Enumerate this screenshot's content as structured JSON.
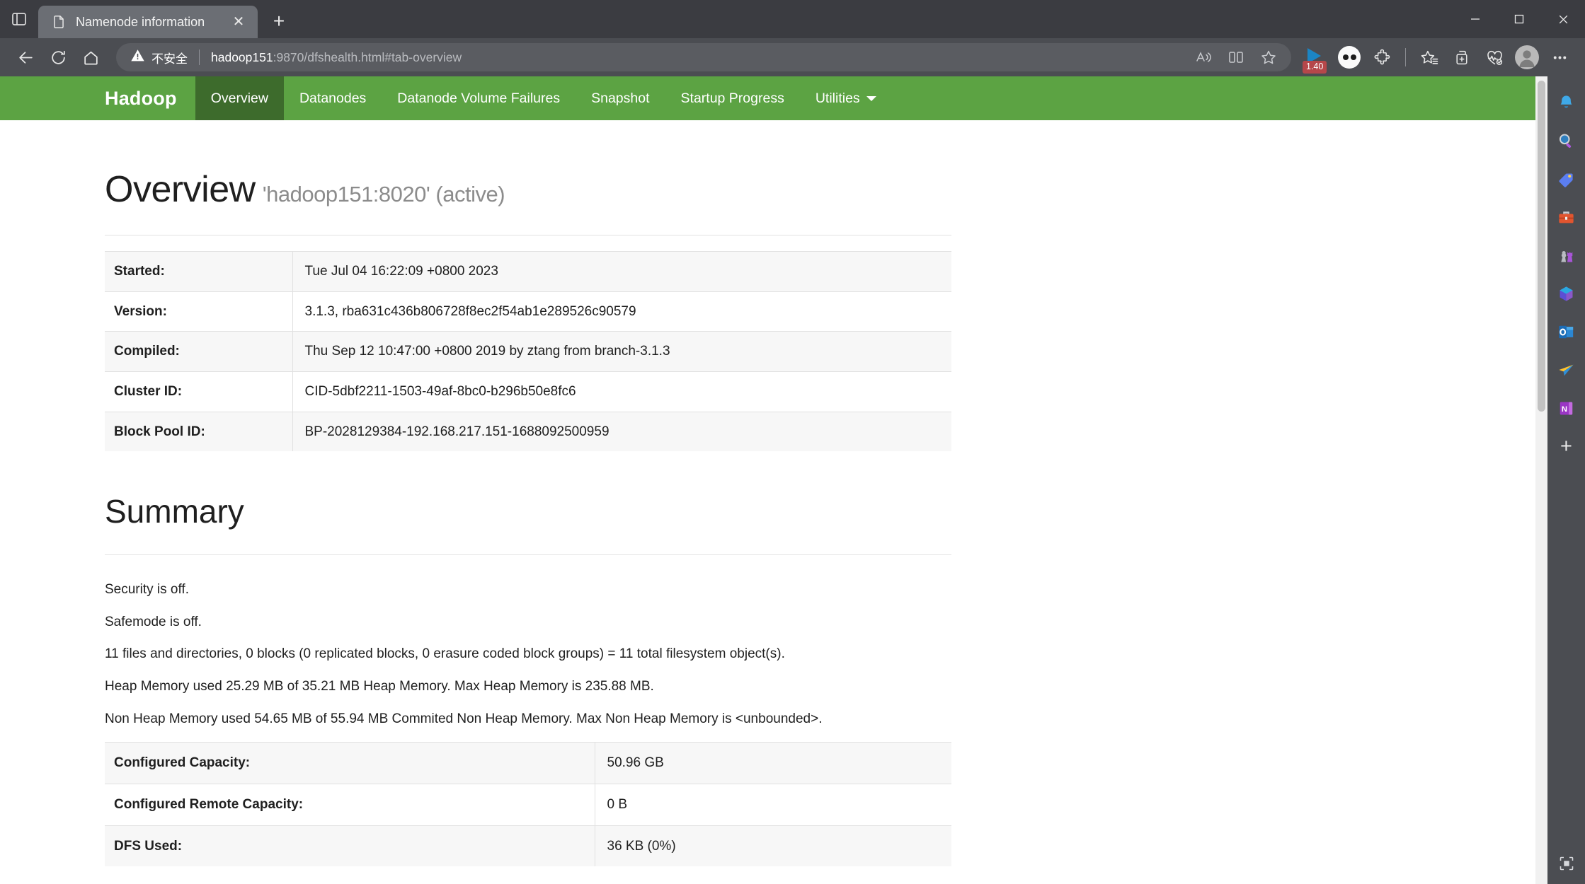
{
  "browser": {
    "tab": {
      "title": "Namenode information",
      "favicon_icon": "page-icon",
      "close_icon": "close-icon"
    },
    "new_tab_label": "+",
    "tab_actions_icon": "tab-actions-icon",
    "window_controls": {
      "minimize": "─",
      "maximize": "□",
      "close": "✕"
    },
    "nav": {
      "back_icon": "back-arrow-icon",
      "refresh_icon": "refresh-icon",
      "home_icon": "home-icon"
    },
    "omnibox": {
      "security_icon": "warning-icon",
      "security_label": "不安全",
      "url_host": "hadoop151",
      "url_path": ":9870/dfshealth.html#tab-overview"
    },
    "toolbar_right": {
      "read_aloud_icon": "read-aloud-icon",
      "split_screen_icon": "split-screen-icon",
      "favorite_icon": "star-icon",
      "player_badge": "1.40",
      "player_icon": "media-play-icon",
      "extension_circle_icon": "extension-dots-icon",
      "extensions_icon": "puzzle-piece-icon",
      "collections_icon": "collections-star-icon",
      "add_collection_icon": "add-to-collections-icon",
      "browser_essentials_icon": "browser-essentials-icon",
      "profile_icon": "profile-avatar-icon",
      "settings_icon": "more-ellipsis-icon"
    },
    "sidebar": {
      "items": [
        {
          "icon": "notifications-bell-icon"
        },
        {
          "icon": "search-magnifier-icon"
        },
        {
          "icon": "shopping-tag-icon"
        },
        {
          "icon": "tools-briefcase-icon"
        },
        {
          "icon": "games-chess-icon"
        },
        {
          "icon": "microsoft365-icon"
        },
        {
          "icon": "outlook-icon"
        },
        {
          "icon": "send-share-icon"
        },
        {
          "icon": "onenote-icon"
        }
      ],
      "add_label": "+",
      "customize_icon": "customize-sidebar-icon"
    }
  },
  "hadoop": {
    "brand": "Hadoop",
    "nav_items": [
      {
        "label": "Overview",
        "active": true
      },
      {
        "label": "Datanodes",
        "active": false
      },
      {
        "label": "Datanode Volume Failures",
        "active": false
      },
      {
        "label": "Snapshot",
        "active": false
      },
      {
        "label": "Startup Progress",
        "active": false
      }
    ],
    "utilities": {
      "label": "Utilities",
      "caret_icon": "chevron-down-icon"
    },
    "overview": {
      "title": "Overview",
      "subtitle": "'hadoop151:8020' (active)",
      "rows": [
        {
          "key": "Started:",
          "value": "Tue Jul 04 16:22:09 +0800 2023"
        },
        {
          "key": "Version:",
          "value": "3.1.3, rba631c436b806728f8ec2f54ab1e289526c90579"
        },
        {
          "key": "Compiled:",
          "value": "Thu Sep 12 10:47:00 +0800 2019 by ztang from branch-3.1.3"
        },
        {
          "key": "Cluster ID:",
          "value": "CID-5dbf2211-1503-49af-8bc0-b296b50e8fc6"
        },
        {
          "key": "Block Pool ID:",
          "value": "BP-2028129384-192.168.217.151-1688092500959"
        }
      ]
    },
    "summary": {
      "title": "Summary",
      "lines": [
        "Security is off.",
        "Safemode is off.",
        "11 files and directories, 0 blocks (0 replicated blocks, 0 erasure coded block groups) = 11 total filesystem object(s).",
        "Heap Memory used 25.29 MB of 35.21 MB Heap Memory. Max Heap Memory is 235.88 MB.",
        "Non Heap Memory used 54.65 MB of 55.94 MB Commited Non Heap Memory. Max Non Heap Memory is <unbounded>."
      ],
      "capacity_rows": [
        {
          "key": "Configured Capacity:",
          "value": "50.96 GB"
        },
        {
          "key": "Configured Remote Capacity:",
          "value": "0 B"
        },
        {
          "key": "DFS Used:",
          "value": "36 KB (0%)"
        }
      ]
    }
  },
  "colors": {
    "hadoop_green": "#5ca343",
    "hadoop_green_active": "#3d6b2c",
    "chrome_bg": "#4b4d52",
    "badge_red": "#b5474a"
  }
}
